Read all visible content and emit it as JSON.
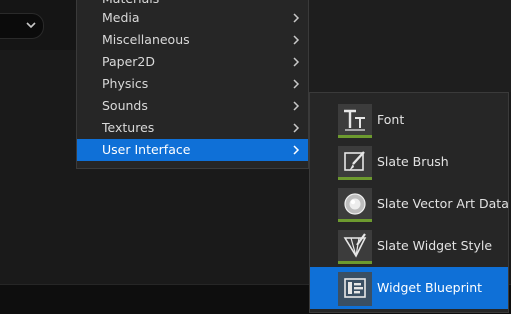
{
  "colors": {
    "selection": "#0f70d7",
    "menu_background": "#262626",
    "asset_accent": "#6d9a2f"
  },
  "context_menu": {
    "items": [
      {
        "label": "Materials",
        "selected": false
      },
      {
        "label": "Media",
        "selected": false
      },
      {
        "label": "Miscellaneous",
        "selected": false
      },
      {
        "label": "Paper2D",
        "selected": false
      },
      {
        "label": "Physics",
        "selected": false
      },
      {
        "label": "Sounds",
        "selected": false
      },
      {
        "label": "Textures",
        "selected": false
      },
      {
        "label": "User Interface",
        "selected": true
      }
    ]
  },
  "submenu": {
    "items": [
      {
        "label": "Font",
        "icon": "font-icon",
        "selected": false
      },
      {
        "label": "Slate Brush",
        "icon": "brush-icon",
        "selected": false
      },
      {
        "label": "Slate Vector Art Data",
        "icon": "sphere-icon",
        "selected": false
      },
      {
        "label": "Slate Widget Style",
        "icon": "widget-style-icon",
        "selected": false
      },
      {
        "label": "Widget Blueprint",
        "icon": "widget-blueprint-icon",
        "selected": true
      }
    ]
  }
}
